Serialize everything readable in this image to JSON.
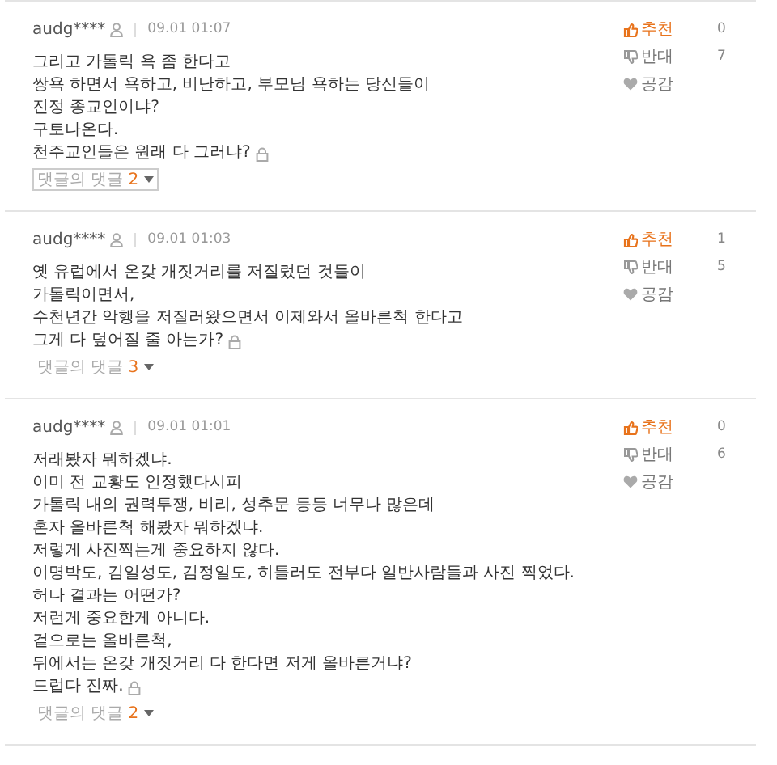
{
  "comments": [
    {
      "author": "audg****",
      "time": "09.01 01:07",
      "text": "그리고 가톨릭 욕 좀 한다고\n쌍욕 하면서 욕하고, 비난하고, 부모님 욕하는 당신들이\n진정 종교인이냐?\n구토나온다.\n천주교인들은 원래 다 그러냐?",
      "votes": [
        {
          "kind": "up",
          "label": "추천",
          "count": "0"
        },
        {
          "kind": "down",
          "label": "반대",
          "count": "7"
        },
        {
          "kind": "empathy",
          "label": "공감"
        }
      ],
      "replies": {
        "label": "댓글의 댓글",
        "count": "2",
        "focused": true
      }
    },
    {
      "author": "audg****",
      "time": "09.01 01:03",
      "text": "옛 유럽에서 온갖 개짓거리를 저질렀던 것들이\n가톨릭이면서,\n수천년간 악행을 저질러왔으면서 이제와서 올바른척 한다고\n그게 다 덮어질 줄 아는가?",
      "votes": [
        {
          "kind": "up",
          "label": "추천",
          "count": "1"
        },
        {
          "kind": "down",
          "label": "반대",
          "count": "5"
        },
        {
          "kind": "empathy",
          "label": "공감"
        }
      ],
      "replies": {
        "label": "댓글의 댓글",
        "count": "3",
        "focused": false
      }
    },
    {
      "author": "audg****",
      "time": "09.01 01:01",
      "text": "저래봤자 뭐하겠냐.\n이미 전 교황도 인정했다시피\n가톨릭 내의 권력투쟁, 비리, 성추문 등등 너무나 많은데\n혼자 올바른척 해봤자 뭐하겠냐.\n저렇게 사진찍는게 중요하지 않다.\n이명박도, 김일성도, 김정일도, 히틀러도 전부다 일반사람들과 사진 찍었다.\n허나 결과는 어떤가?\n저런게 중요한게 아니다.\n겉으로는 올바른척,\n뒤에서는 온갖 개짓거리 다 한다면 저게 올바른거냐?\n드럽다 진짜.",
      "votes": [
        {
          "kind": "up",
          "label": "추천",
          "count": "0"
        },
        {
          "kind": "down",
          "label": "반대",
          "count": "6"
        },
        {
          "kind": "empathy",
          "label": "공감"
        }
      ],
      "replies": {
        "label": "댓글의 댓글",
        "count": "2",
        "focused": false
      }
    }
  ]
}
